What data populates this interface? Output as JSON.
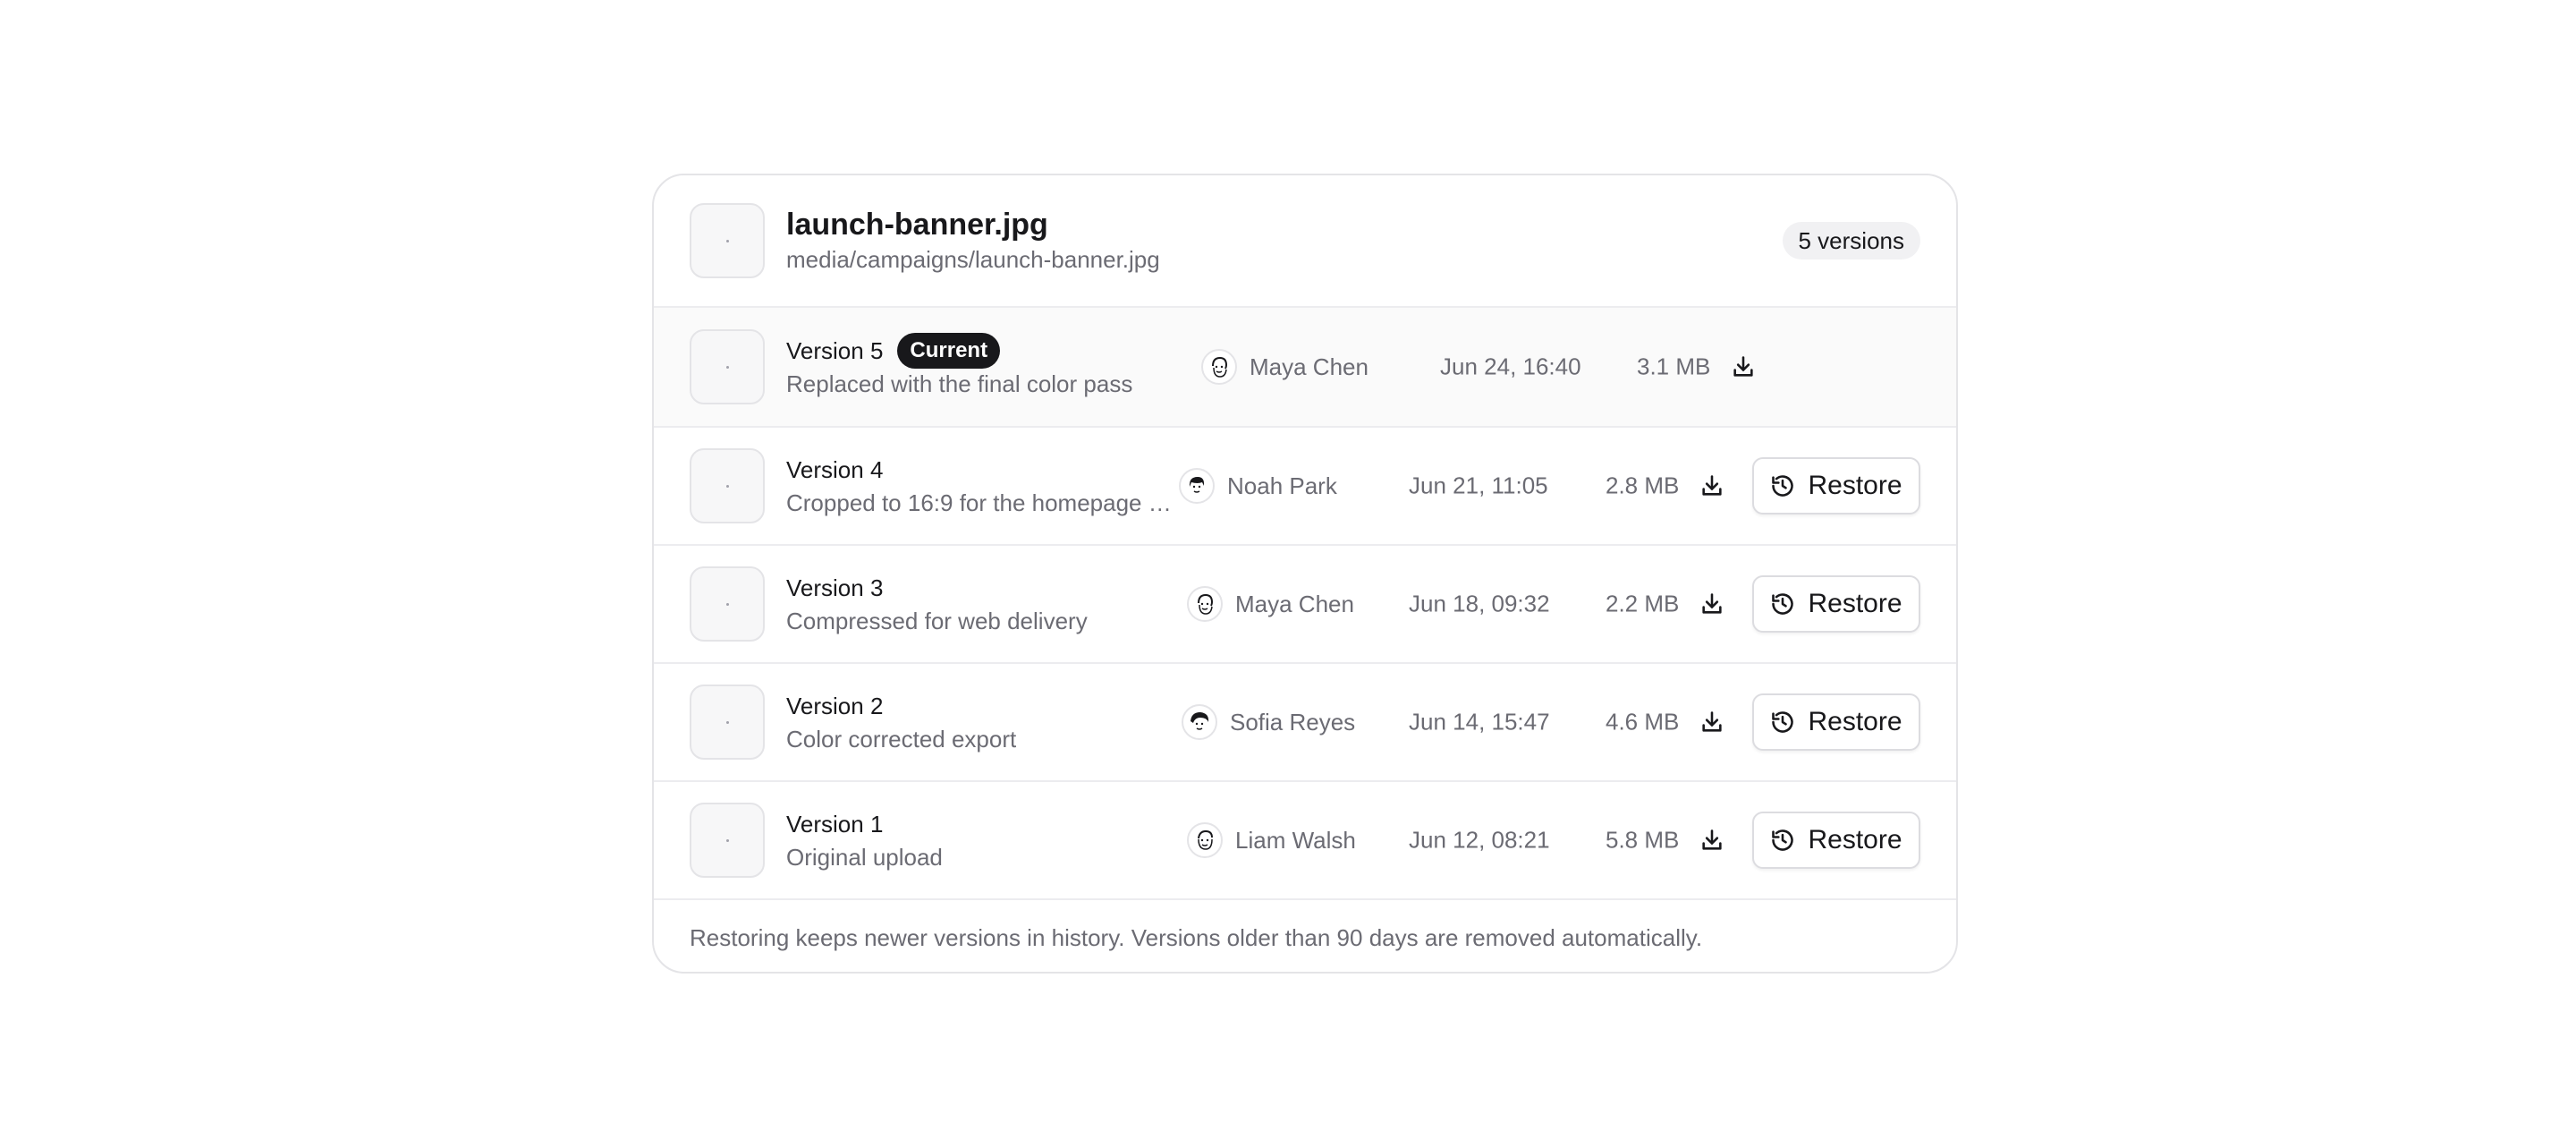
{
  "file": {
    "name": "launch-banner.jpg",
    "path": "media/campaigns/launch-banner.jpg",
    "version_count": "5 versions"
  },
  "current_badge": "Current",
  "restore_label": "Restore",
  "versions": [
    {
      "title": "Version 5",
      "description": "Replaced with the final color pass",
      "author": "Maya Chen",
      "date": "Jun 24, 16:40",
      "size": "3.1 MB",
      "current": true
    },
    {
      "title": "Version 4",
      "description": "Cropped to 16:9 for the homepage h...",
      "author": "Noah Park",
      "date": "Jun 21, 11:05",
      "size": "2.8 MB",
      "current": false
    },
    {
      "title": "Version 3",
      "description": "Compressed for web delivery",
      "author": "Maya Chen",
      "date": "Jun 18, 09:32",
      "size": "2.2 MB",
      "current": false
    },
    {
      "title": "Version 2",
      "description": "Color corrected export",
      "author": "Sofia Reyes",
      "date": "Jun 14, 15:47",
      "size": "4.6 MB",
      "current": false
    },
    {
      "title": "Version 1",
      "description": "Original upload",
      "author": "Liam Walsh",
      "date": "Jun 12, 08:21",
      "size": "5.8 MB",
      "current": false
    }
  ],
  "footer_note": "Restoring keeps newer versions in history. Versions older than 90 days are removed automatically.",
  "icons": {
    "download": "download-icon",
    "restore": "history-icon",
    "avatar": "avatar-illustration"
  },
  "colors": {
    "badge_bg": "#18181b",
    "muted_text": "#6b6b73",
    "border": "#e4e4e7",
    "current_row_bg": "#fafafa"
  }
}
